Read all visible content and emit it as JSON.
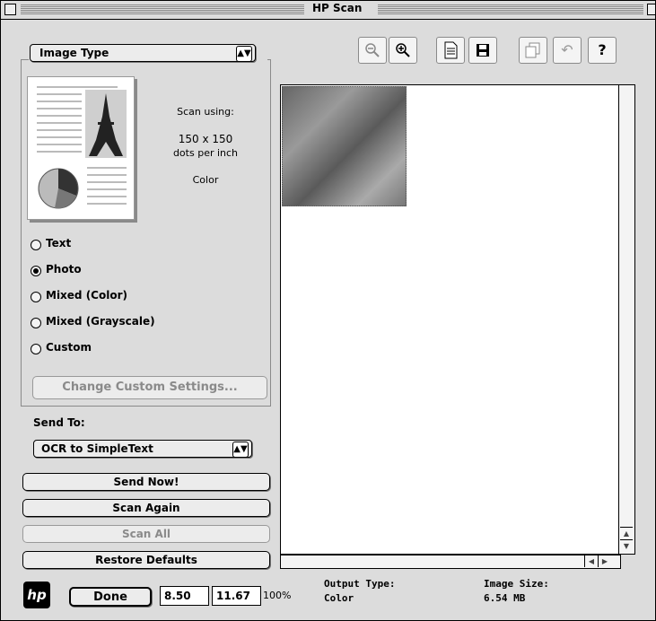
{
  "window": {
    "title": "HP Scan"
  },
  "image_type": {
    "label": "Image Type",
    "scan_using_label": "Scan using:",
    "resolution": "150 x 150",
    "resolution_unit": "dots per inch",
    "color_mode": "Color",
    "options": [
      "Text",
      "Photo",
      "Mixed (Color)",
      "Mixed (Grayscale)",
      "Custom"
    ],
    "selected": "Photo",
    "change_custom_label": "Change Custom Settings..."
  },
  "send_to": {
    "label": "Send To:",
    "selected": "OCR to SimpleText"
  },
  "actions": {
    "send_now": "Send Now!",
    "scan_again": "Scan Again",
    "scan_all": "Scan All",
    "restore_defaults": "Restore Defaults",
    "done": "Done"
  },
  "toolbar": {
    "icons": [
      "zoom-out-icon",
      "zoom-in-icon",
      "print-icon",
      "save-icon",
      "copy-icon",
      "undo-icon",
      "help-icon"
    ]
  },
  "bottom": {
    "width": "8.50",
    "height": "11.67",
    "zoom": "100%",
    "output_type_label": "Output Type:",
    "output_type_value": "Color",
    "image_size_label": "Image Size:",
    "image_size_value": "6.54 MB"
  }
}
